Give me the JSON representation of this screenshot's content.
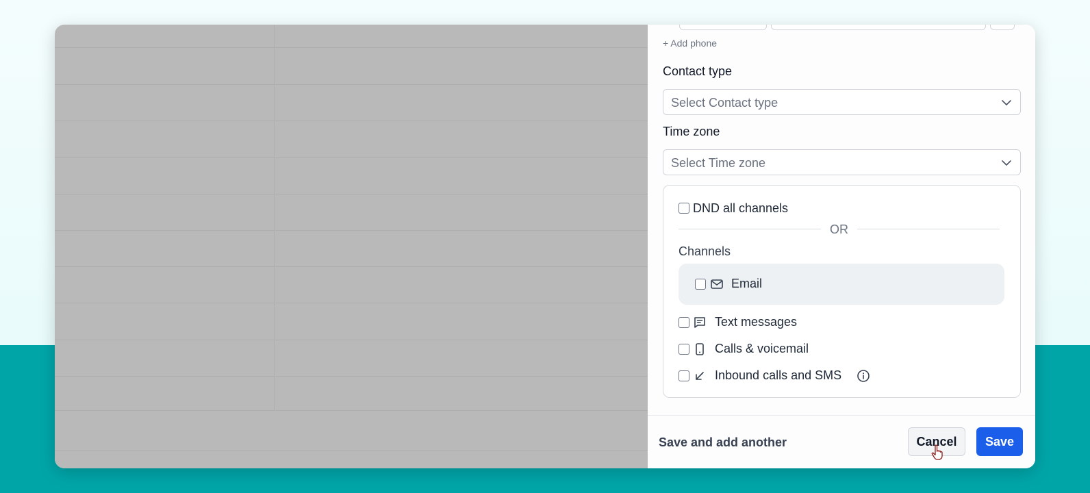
{
  "drawer": {
    "add_phone_label": "+ Add phone",
    "contact_type": {
      "label": "Contact type",
      "placeholder": "Select Contact type"
    },
    "time_zone": {
      "label": "Time zone",
      "placeholder": "Select Time zone"
    },
    "dnd": {
      "all_channels_label": "DND all channels",
      "or_label": "OR",
      "channels_heading": "Channels",
      "channels": [
        {
          "label": "Email",
          "icon": "mail-icon",
          "checked": false
        },
        {
          "label": "Text messages",
          "icon": "message-square-icon",
          "checked": false
        },
        {
          "label": "Calls & voicemail",
          "icon": "smartphone-icon",
          "checked": false
        },
        {
          "label": "Inbound calls and SMS",
          "icon": "arrow-down-left-icon",
          "checked": false
        }
      ]
    },
    "footer": {
      "save_and_add_another": "Save and add another",
      "cancel": "Cancel",
      "save": "Save"
    }
  },
  "colors": {
    "accent": "#1a5eea",
    "page_band": "#00a5a8",
    "overlay": "#b9b9b9"
  }
}
